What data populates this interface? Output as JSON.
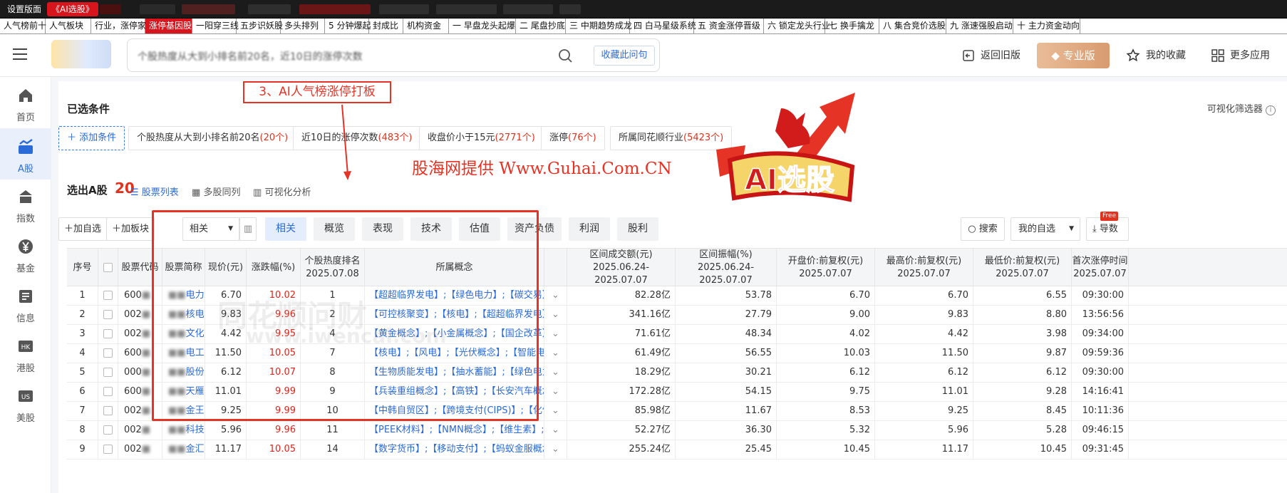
{
  "top_tabs_1": [
    "设置版面",
    "《AI选股》"
  ],
  "top_tabs_2": [
    "人气榜前十",
    "人气板块",
    "行业，涨停家数",
    "涨停基因股",
    "一阳穿三线",
    "五步识妖股",
    "多头排列",
    "5 分钟爆起",
    "封成比",
    "机构资金",
    "一 早盘龙头起爆",
    "二 尾盘抄底",
    "三 中期趋势成龙",
    "四 白马星级系统",
    "五 资金涨停晋级",
    "六 锁定龙头行业",
    "七 换手擒龙",
    "八 集合竞价选股",
    "九 涨速强股启动",
    "十 主力资金动向"
  ],
  "header": {
    "search_text": "个股热度从大到小排名前20名，近10日的涨停次数",
    "favorite_query": "收藏此问句",
    "back_old": "返回旧版",
    "pro": "专业版",
    "my_fav": "我的收藏",
    "more_apps": "更多应用"
  },
  "sidenav": [
    "首页",
    "A股",
    "指数",
    "基金",
    "信息",
    "港股",
    "美股"
  ],
  "conditions": {
    "title": "已选条件",
    "visual_filter": "可视化筛选器",
    "add": "添加条件",
    "chips": [
      {
        "text": "个股热度从大到小排名前20名",
        "count": "(20个)"
      },
      {
        "text": "近10日的涨停次数",
        "count": "(483个)"
      },
      {
        "text": "收盘价小于15元",
        "count": "(2771个)"
      },
      {
        "text": "涨停",
        "count": "(76个)"
      },
      {
        "text": "所属同花顺行业",
        "count": "(5423个)"
      }
    ]
  },
  "results": {
    "title": "选出A股",
    "count": "20",
    "tab_list": "股票列表",
    "tab_multi": "多股同列",
    "tab_viz": "可视化分析"
  },
  "toolbar": {
    "add_pick": "加自选",
    "add_block": "加板块",
    "sort_select": "相关",
    "segments": [
      "相关",
      "概览",
      "表现",
      "技术",
      "估值",
      "资产负债",
      "利润",
      "股利"
    ],
    "search": "搜索",
    "my_pick": "我的自选",
    "export": "导数",
    "free": "Free"
  },
  "table": {
    "headers": [
      "序号",
      "",
      "股票代码",
      "股票简称",
      "现价(元)",
      "涨跌幅(%)",
      "个股热度排名|2025.07.08",
      "所属概念",
      "",
      "区间成交额(元)|2025.06.24-2025.07.07",
      "区间振幅(%)|2025.06.24-2025.07.07",
      "开盘价:前复权(元)|2025.07.07",
      "最高价:前复权(元)|2025.07.07",
      "最低价:前复权(元)|2025.07.07",
      "首次涨停时间|2025.07.07"
    ],
    "rows": [
      [
        "1",
        "600",
        "电力",
        "6.70",
        "10.02",
        "1",
        "【超超临界发电】;【绿色电力】;【碳交易】;【",
        "82.28亿",
        "53.78",
        "6.70",
        "6.70",
        "6.55",
        "09:30:00"
      ],
      [
        "2",
        "002",
        "核电",
        "9.83",
        "9.96",
        "2",
        "【可控核聚变】;【核电】;【超超临界发电】;【",
        "341.16亿",
        "27.79",
        "9.00",
        "9.83",
        "8.80",
        "13:56:56"
      ],
      [
        "3",
        "002",
        "文化",
        "4.42",
        "9.95",
        "4",
        "【黄金概念】;【小金属概念】;【国企改革】;【",
        "71.61亿",
        "48.34",
        "4.02",
        "4.42",
        "3.98",
        "09:34:00"
      ],
      [
        "4",
        "600",
        "电工",
        "11.50",
        "10.05",
        "7",
        "【核电】;【风电】;【光伏概念】;【智能电网】",
        "61.49亿",
        "56.55",
        "10.03",
        "11.50",
        "9.87",
        "09:59:36"
      ],
      [
        "5",
        "000",
        "股份",
        "6.12",
        "10.07",
        "8",
        "【生物质能发电】;【抽水蓄能】;【绿色电力】",
        "18.29亿",
        "30.21",
        "6.12",
        "6.12",
        "6.12",
        "09:30:00"
      ],
      [
        "6",
        "600",
        "天雁",
        "11.01",
        "9.99",
        "9",
        "【兵装重组概念】;【高铁】;【长安汽车概念】;",
        "172.28亿",
        "54.15",
        "9.75",
        "11.01",
        "9.28",
        "14:16:41"
      ],
      [
        "7",
        "002",
        "金王",
        "9.25",
        "9.99",
        "10",
        "【中韩自贸区】;【跨境支付(CIPS)】;【化债概",
        "85.98亿",
        "11.67",
        "8.53",
        "9.25",
        "8.45",
        "10:11:36"
      ],
      [
        "8",
        "002",
        "科技",
        "5.96",
        "9.96",
        "11",
        "【PEEK材料】;【NMN概念】;【维生素】;【合",
        "52.27亿",
        "36.30",
        "5.32",
        "5.96",
        "5.28",
        "09:46:15"
      ],
      [
        "9",
        "002",
        "金汇",
        "11.17",
        "10.05",
        "14",
        "【数字货币】;【移动支付】;【蚂蚁金服概念】;",
        "255.24亿",
        "25.45",
        "10.45",
        "11.17",
        "10.45",
        "09:31:45"
      ]
    ]
  },
  "annotations": {
    "label": "3、AI人气榜涨停打板",
    "credit": "股海网提供 Www.Guhai.Com.CN",
    "badge": "AI选股",
    "watermark": "同花顺问财",
    "watermark2": "www.iwencai.com"
  }
}
